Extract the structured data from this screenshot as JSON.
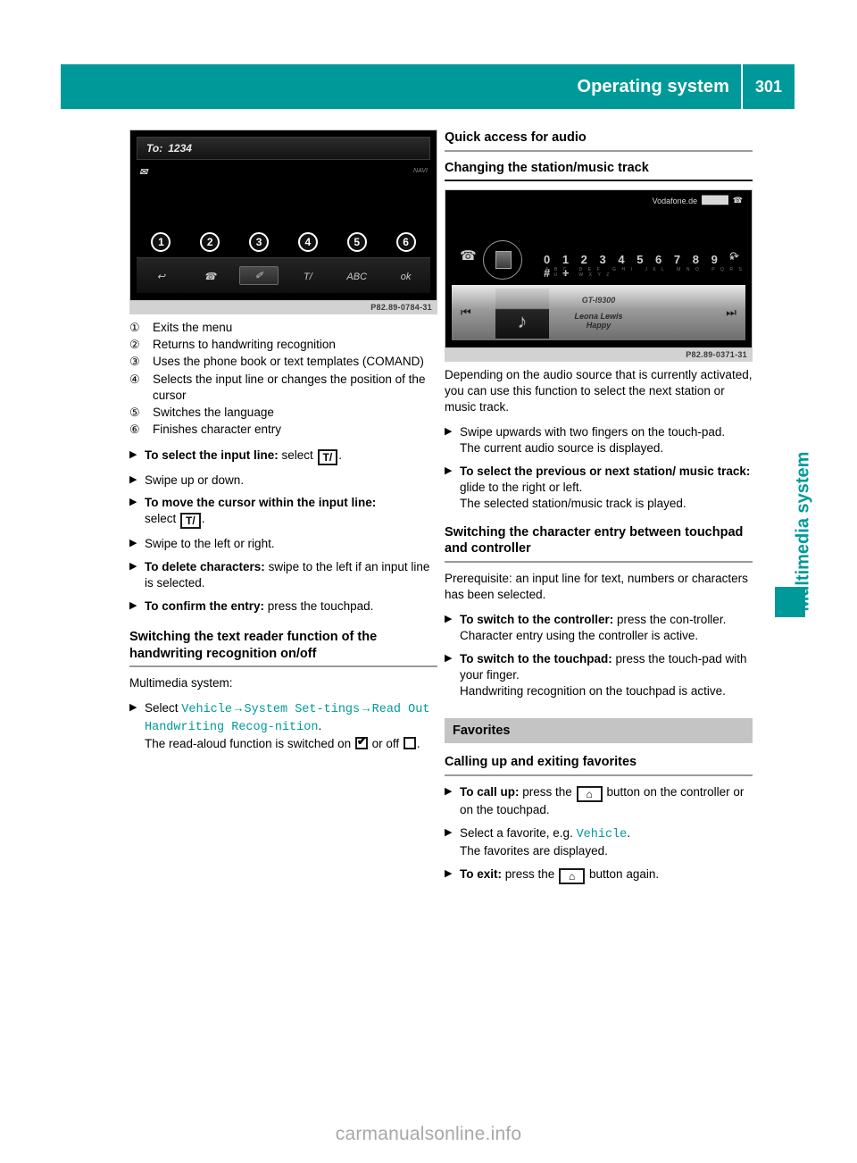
{
  "header": {
    "title": "Operating system",
    "page_number": "301",
    "accent_color": "#009999"
  },
  "side_tab": {
    "label": "Multimedia system"
  },
  "figures": {
    "handwriting": {
      "caption_code": "P82.89-0784-31",
      "to_label": "To:",
      "to_value": "1234",
      "envelope_icon": "envelope-icon",
      "navi_label": "NAVI",
      "callouts": [
        "1",
        "2",
        "3",
        "4",
        "5",
        "6"
      ],
      "toolbar_icons": [
        "↩",
        "☎",
        "✐",
        "T/",
        "ABC",
        "ok"
      ]
    },
    "audio": {
      "caption_code": "P82.89-0371-31",
      "carrier": "Vodafone.de",
      "signal_bars": "▉▉▉▉▉",
      "keypad": "0 1 2 3 4 5 6 7 8 9 * # +",
      "keypad_sub": "ABC DEF GHI JKL MNO PQRS TUV WXYZ",
      "device_name": "GT-I9300",
      "artist": "Leona Lewis",
      "track": "Happy",
      "prev_icon": "skip-back-icon",
      "next_icon": "skip-forward-icon",
      "note_icon": "music-note-icon"
    }
  },
  "left_column": {
    "legend": [
      {
        "marker": "①",
        "text": "Exits the menu"
      },
      {
        "marker": "②",
        "text": "Returns to handwriting recognition"
      },
      {
        "marker": "③",
        "text": "Uses the phone book or text templates (COMAND)"
      },
      {
        "marker": "④",
        "text": "Selects the input line or changes the position of the cursor"
      },
      {
        "marker": "⑤",
        "text": "Switches the language"
      },
      {
        "marker": "⑥",
        "text": "Finishes character entry"
      }
    ],
    "steps": [
      {
        "bold": "To select the input line:",
        "rest": " select ",
        "glyph": "T/",
        "tail": "."
      },
      {
        "bold": "",
        "rest": "Swipe up or down.",
        "glyph": "",
        "tail": ""
      },
      {
        "bold": "To move the cursor within the input line:",
        "rest": " select ",
        "glyph": "T/",
        "tail": "."
      },
      {
        "bold": "",
        "rest": "Swipe to the left or right.",
        "glyph": "",
        "tail": ""
      },
      {
        "bold": "To delete characters:",
        "rest": " swipe to the left if an input line is selected.",
        "glyph": "",
        "tail": ""
      },
      {
        "bold": "To confirm the entry:",
        "rest": " press the touchpad.",
        "glyph": "",
        "tail": ""
      }
    ],
    "text_reader": {
      "heading": "Switching the text reader function of the handwriting recognition on/off",
      "intro": "Multimedia system:",
      "select_label": "Select ",
      "path": [
        "Vehicle",
        "System Set‑tings",
        "Read Out Handwriting Recog‑nition"
      ],
      "arrow": "→",
      "result_prefix": "The read-aloud function is switched on ",
      "result_middle": " or off ",
      "result_suffix": "."
    }
  },
  "right_column": {
    "quick_access_heading": "Quick access for audio",
    "changing_station_heading": "Changing the station/music track",
    "changing_station_body": "Depending on the audio source that is currently activated, you can use this function to select the next station or music track.",
    "changing_station_steps": [
      {
        "bold": "",
        "rest": "Swipe upwards with two fingers on the touch‑pad.",
        "sub": "The current audio source is displayed."
      },
      {
        "bold": "To select the previous or next station/ music track:",
        "rest": " glide to the right or left.",
        "sub": "The selected station/music track is played."
      }
    ],
    "switching_heading": "Switching the character entry between touchpad and controller",
    "switching_body": "Prerequisite: an input line for text, numbers or characters has been selected.",
    "switching_steps": [
      {
        "bold": "To switch to the controller:",
        "rest": " press the con‑troller.",
        "sub": "Character entry using the controller is active."
      },
      {
        "bold": "To switch to the touchpad:",
        "rest": " press the touch‑pad with your finger.",
        "sub": "Handwriting recognition on the touchpad is active."
      }
    ],
    "favorites_band": "Favorites",
    "favorites_heading": "Calling up and exiting favorites",
    "favorites_steps": [
      {
        "bold": "To call up:",
        "mid": " press the ",
        "glyph": "home-icon",
        "tail": " button on the controller or on the touchpad."
      },
      {
        "bold": "",
        "mid": "Select a favorite, e.g. ",
        "link": "Vehicle",
        "tail": ".",
        "sub": "The favorites are displayed."
      },
      {
        "bold": "To exit:",
        "mid": " press the ",
        "glyph": "home-icon",
        "tail": " button again."
      }
    ]
  },
  "watermark": "carmanualsonline.info",
  "bullet_marker": "▶"
}
